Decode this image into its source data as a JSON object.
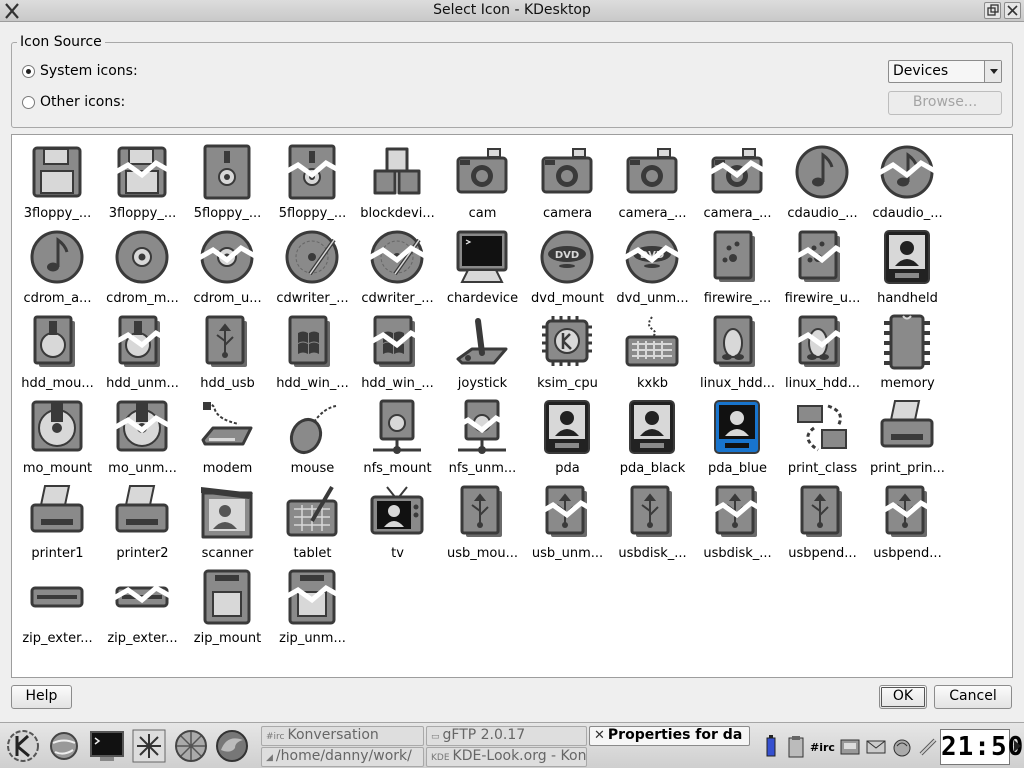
{
  "window": {
    "title": "Select Icon - KDesktop"
  },
  "icon_source": {
    "legend": "Icon Source",
    "system_label": "System icons:",
    "system_checked": true,
    "other_label": "Other icons:",
    "other_checked": false,
    "category_value": "Devices",
    "browse_label": "Browse..."
  },
  "icons": [
    {
      "label": "3floppy_...",
      "shape": "floppy"
    },
    {
      "label": "3floppy_...",
      "shape": "floppy-split"
    },
    {
      "label": "5floppy_...",
      "shape": "floppy5"
    },
    {
      "label": "5floppy_...",
      "shape": "floppy5-split"
    },
    {
      "label": "blockdevi...",
      "shape": "blocks"
    },
    {
      "label": "cam",
      "shape": "camera"
    },
    {
      "label": "camera",
      "shape": "camera"
    },
    {
      "label": "camera_...",
      "shape": "camera"
    },
    {
      "label": "camera_...",
      "shape": "camera-split"
    },
    {
      "label": "cdaudio_...",
      "shape": "note-disc"
    },
    {
      "label": "cdaudio_...",
      "shape": "note-disc-split"
    },
    {
      "label": "cdrom_a...",
      "shape": "note-disc"
    },
    {
      "label": "cdrom_m...",
      "shape": "disc"
    },
    {
      "label": "cdrom_u...",
      "shape": "disc-split"
    },
    {
      "label": "cdwriter_...",
      "shape": "disc-pen"
    },
    {
      "label": "cdwriter_...",
      "shape": "disc-pen-split"
    },
    {
      "label": "chardevice",
      "shape": "monitor"
    },
    {
      "label": "dvd_mount",
      "shape": "dvd"
    },
    {
      "label": "dvd_unm...",
      "shape": "dvd-split"
    },
    {
      "label": "firewire_...",
      "shape": "drive"
    },
    {
      "label": "firewire_u...",
      "shape": "drive-split"
    },
    {
      "label": "handheld",
      "shape": "pda"
    },
    {
      "label": "hdd_mou...",
      "shape": "hdd"
    },
    {
      "label": "hdd_unm...",
      "shape": "hdd-split"
    },
    {
      "label": "hdd_usb",
      "shape": "usb-drive"
    },
    {
      "label": "hdd_win_...",
      "shape": "win-drive"
    },
    {
      "label": "hdd_win_...",
      "shape": "win-drive-split"
    },
    {
      "label": "joystick",
      "shape": "joystick"
    },
    {
      "label": "ksim_cpu",
      "shape": "cpu"
    },
    {
      "label": "kxkb",
      "shape": "keyboard"
    },
    {
      "label": "linux_hdd...",
      "shape": "linux-drive"
    },
    {
      "label": "linux_hdd...",
      "shape": "linux-drive-split"
    },
    {
      "label": "memory",
      "shape": "memory"
    },
    {
      "label": "mo_mount",
      "shape": "mo"
    },
    {
      "label": "mo_unm...",
      "shape": "mo-split"
    },
    {
      "label": "modem",
      "shape": "modem"
    },
    {
      "label": "mouse",
      "shape": "mouse"
    },
    {
      "label": "nfs_mount",
      "shape": "nfs"
    },
    {
      "label": "nfs_unm...",
      "shape": "nfs-split"
    },
    {
      "label": "pda",
      "shape": "pda"
    },
    {
      "label": "pda_black",
      "shape": "pda"
    },
    {
      "label": "pda_blue",
      "shape": "pda-blue"
    },
    {
      "label": "print_class",
      "shape": "print-class"
    },
    {
      "label": "print_prin...",
      "shape": "printer"
    },
    {
      "label": "printer1",
      "shape": "printer"
    },
    {
      "label": "printer2",
      "shape": "printer"
    },
    {
      "label": "scanner",
      "shape": "scanner"
    },
    {
      "label": "tablet",
      "shape": "tablet"
    },
    {
      "label": "tv",
      "shape": "tv"
    },
    {
      "label": "usb_mou...",
      "shape": "usb-drive"
    },
    {
      "label": "usb_unm...",
      "shape": "usb-drive-split"
    },
    {
      "label": "usbdisk_...",
      "shape": "usb-drive"
    },
    {
      "label": "usbdisk_...",
      "shape": "usb-drive-split"
    },
    {
      "label": "usbpend...",
      "shape": "usb-drive"
    },
    {
      "label": "usbpend...",
      "shape": "usb-drive-split"
    },
    {
      "label": "zip_exter...",
      "shape": "zip-ext"
    },
    {
      "label": "zip_exter...",
      "shape": "zip-ext-split"
    },
    {
      "label": "zip_mount",
      "shape": "zip"
    },
    {
      "label": "zip_unm...",
      "shape": "zip-split"
    }
  ],
  "buttons": {
    "help": "Help",
    "ok": "OK",
    "cancel": "Cancel"
  },
  "taskbar": {
    "tasks": [
      {
        "tag": "#irc",
        "label": "Konversation"
      },
      {
        "tag": "",
        "label": "gFTP 2.0.17"
      },
      {
        "tag": "",
        "label": "Properties for da"
      },
      {
        "tag": "",
        "label": "/home/danny/work/"
      },
      {
        "tag": "KDE",
        "label": "KDE-Look.org - Kon"
      }
    ],
    "tray_irc": "#irc",
    "clock": "21:50"
  }
}
